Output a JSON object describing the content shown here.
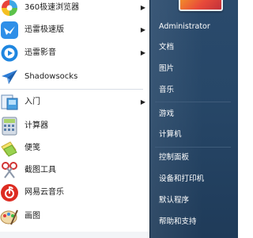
{
  "programs": [
    {
      "label": "360极速浏览器",
      "icon": "360-browser-icon",
      "has_arrow": true
    },
    {
      "label": "迅雷极速版",
      "icon": "thunder-icon",
      "has_arrow": true
    },
    {
      "label": "迅雷影音",
      "icon": "thunder-player-icon",
      "has_arrow": true
    },
    {
      "label": "Shadowsocks",
      "icon": "shadowsocks-icon",
      "has_arrow": false
    },
    {
      "label": "入门",
      "icon": "getting-started-icon",
      "has_arrow": true
    },
    {
      "label": "计算器",
      "icon": "calculator-icon",
      "has_arrow": false
    },
    {
      "label": "便笺",
      "icon": "sticky-notes-icon",
      "has_arrow": false
    },
    {
      "label": "截图工具",
      "icon": "snipping-tool-icon",
      "has_arrow": false
    },
    {
      "label": "网易云音乐",
      "icon": "netease-music-icon",
      "has_arrow": false
    },
    {
      "label": "画图",
      "icon": "paint-icon",
      "has_arrow": false
    }
  ],
  "arrow_glyph": "▶",
  "right_pane": {
    "items": [
      "Administrator",
      "文档",
      "图片",
      "音乐",
      "游戏",
      "计算机",
      "控制面板",
      "设备和打印机",
      "默认程序",
      "帮助和支持"
    ]
  },
  "colors": {
    "right_pane_bg": "#274768",
    "nav_text": "#ffffff"
  }
}
